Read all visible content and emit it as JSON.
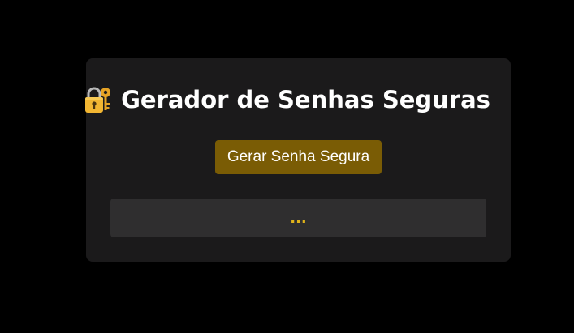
{
  "header": {
    "icon": "lock-with-key-icon",
    "title": "Gerador de Senhas Seguras"
  },
  "actions": {
    "generate_label": "Gerar Senha Segura"
  },
  "output": {
    "value": "..."
  },
  "colors": {
    "page_background": "#000000",
    "card_background": "#1b1a1b",
    "button_background": "#7a5c05",
    "output_background": "#2f2e2f",
    "output_text": "#e0b31a",
    "title_text": "#ffffff"
  }
}
